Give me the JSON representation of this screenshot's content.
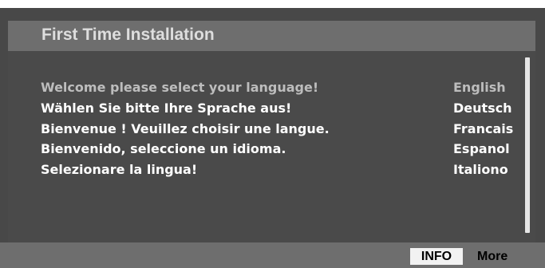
{
  "header": {
    "title": "First Time Installation"
  },
  "languages": [
    {
      "prompt": "Welcome please select your language!",
      "language": "English",
      "selected": true
    },
    {
      "prompt": "Wählen Sie bitte Ihre Sprache aus!",
      "language": "Deutsch",
      "selected": false
    },
    {
      "prompt": "Bienvenue ! Veuillez choisir une langue.",
      "language": "Francais",
      "selected": false
    },
    {
      "prompt": "Bienvenido, seleccione un idioma.",
      "language": "Espanol",
      "selected": false
    },
    {
      "prompt": "Selezionare la lingua!",
      "language": "Italiono",
      "selected": false
    }
  ],
  "footer": {
    "info_label": "INFO",
    "more_label": "More"
  },
  "colors": {
    "background": "#484848",
    "titlebar": "#6e6e6e",
    "highlight_text": "#bdbdbd",
    "text": "#ffffff"
  }
}
